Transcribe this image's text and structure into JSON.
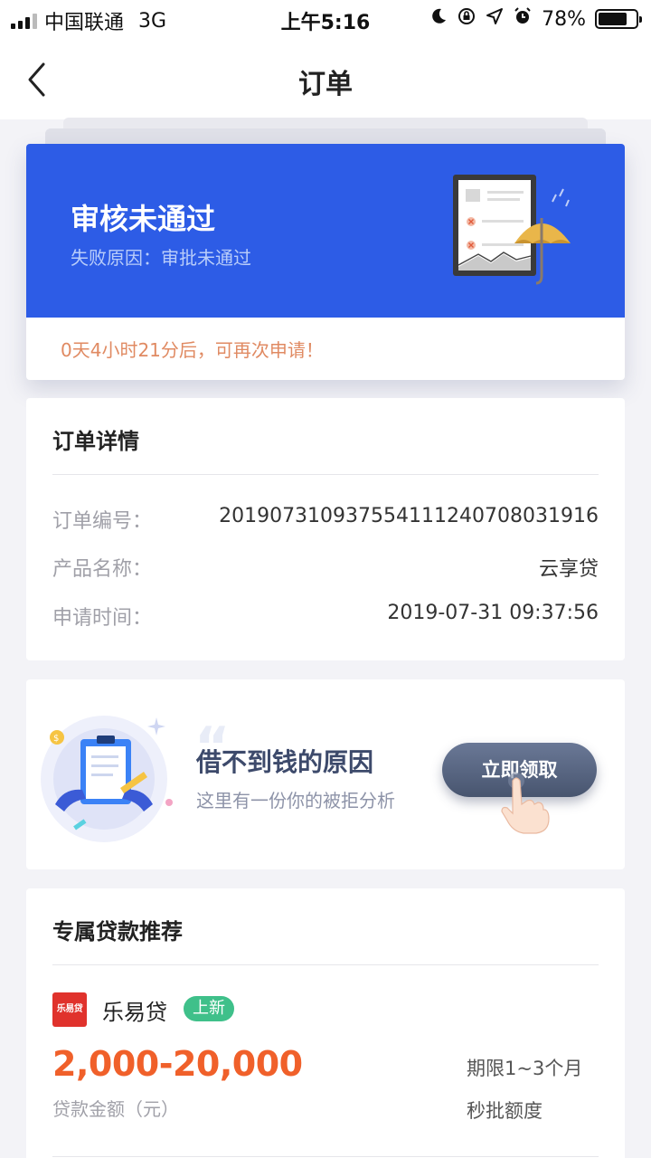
{
  "status_bar": {
    "carrier": "中国联通",
    "network": "3G",
    "time": "上午5:16",
    "battery_percent": "78%",
    "battery_level": 0.78
  },
  "nav": {
    "title": "订单",
    "back_icon": "chevron-left-icon"
  },
  "status_card": {
    "title": "审核未通过",
    "reason": "失败原因：审批未通过",
    "countdown": "0天4小时21分后，可再次申请！",
    "banner_color": "#2d5ce6",
    "countdown_color": "#e08a62"
  },
  "order_detail": {
    "title": "订单详情",
    "rows": [
      {
        "label": "订单编号：",
        "value": "20190731093755411124070803191​6"
      },
      {
        "label": "产品名称：",
        "value": "云享贷"
      },
      {
        "label": "申请时间：",
        "value": "2019-07-31 09:37:56"
      }
    ]
  },
  "reason_promo": {
    "title": "借不到钱的原因",
    "subtitle": "这里有一份你的被拒分析",
    "button_label": "立即领取"
  },
  "recommend": {
    "title": "专属贷款推荐",
    "items": [
      {
        "logo_text": "乐易贷",
        "name": "乐易贷",
        "badge": "上新",
        "amount": "2,000-20,000",
        "amount_label": "贷款金额（元）",
        "term": "期限1~3个月",
        "feature": "秒批额度"
      }
    ],
    "amount_color": "#f0602a",
    "badge_color": "#3fc08a"
  }
}
